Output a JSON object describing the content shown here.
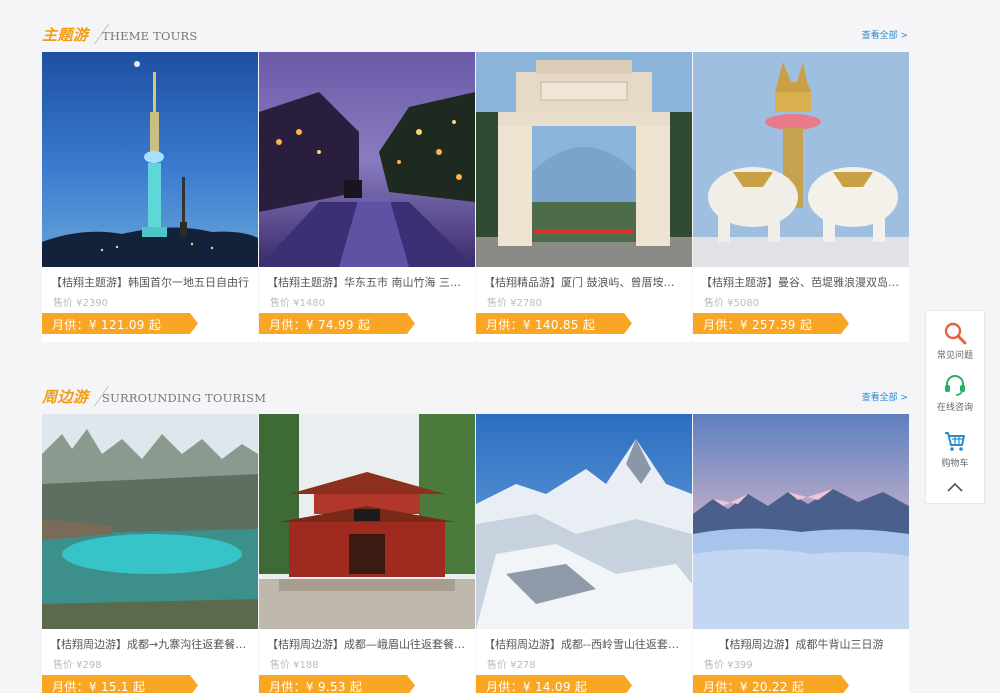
{
  "sections": [
    {
      "title": "主题游",
      "subtitle": "THEME TOURS",
      "more": "查看全部 >",
      "cards": [
        {
          "name": "【桔翔主题游】韩国首尔一地五日自由行",
          "price": "售价 ¥2390",
          "monthly": "月供：¥ 121.09 起"
        },
        {
          "name": "【桔翔主题游】华东五市 南山竹海 三国...",
          "price": "售价 ¥1480",
          "monthly": "月供：¥ 74.99 起"
        },
        {
          "name": "【桔翔精品游】厦门 鼓浪屿、曾厝垵双飞...",
          "price": "售价 ¥2780",
          "monthly": "月供：¥ 140.85 起"
        },
        {
          "name": "【桔翔主题游】曼谷、芭堤雅浪漫双岛五...",
          "price": "售价 ¥5080",
          "monthly": "月供：¥ 257.39 起"
        }
      ]
    },
    {
      "title": "周边游",
      "subtitle": "SURROUNDING TOURISM",
      "more": "查看全部 >",
      "cards": [
        {
          "name": "【桔翔周边游】成都→九寨沟往返套餐三...",
          "price": "售价 ¥298",
          "monthly": "月供：¥ 15.1 起"
        },
        {
          "name": "【桔翔周边游】成都—峨眉山往返套餐二...",
          "price": "售价 ¥188",
          "monthly": "月供：¥ 9.53 起"
        },
        {
          "name": "【桔翔周边游】成都--西岭雪山往返套餐...",
          "price": "售价 ¥278",
          "monthly": "月供：¥ 14.09 起"
        },
        {
          "name": "【桔翔周边游】成都牛背山三日游",
          "price": "售价 ¥399",
          "monthly": "月供：¥ 20.22 起"
        }
      ]
    }
  ],
  "sidebar": {
    "faq": "常见问题",
    "consult": "在线咨询",
    "cart": "购物车"
  },
  "colors": {
    "accent": "#f9a625",
    "title": "#f39c12",
    "link": "#2a8ccf",
    "icon_faq": "#e8603c",
    "icon_consult": "#27ae60",
    "icon_cart": "#2a8ccf"
  }
}
